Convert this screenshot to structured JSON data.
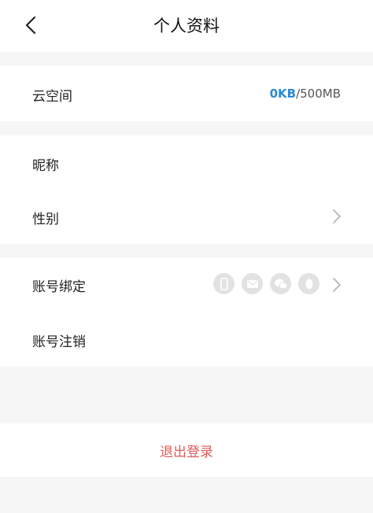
{
  "header": {
    "title": "个人资料"
  },
  "cloud": {
    "label": "云空间",
    "used": "0KB",
    "separator": "/",
    "total": "500MB"
  },
  "profile": {
    "nickname_label": "昵称",
    "gender_label": "性别"
  },
  "account": {
    "bind_label": "账号绑定",
    "cancel_label": "账号注销",
    "bind_icons": [
      "phone-icon",
      "mail-icon",
      "wechat-icon",
      "qq-icon"
    ]
  },
  "logout_label": "退出登录",
  "colors": {
    "accent": "#2b8ad8",
    "logout": "#e05a5a",
    "background": "#f6f6f6"
  }
}
